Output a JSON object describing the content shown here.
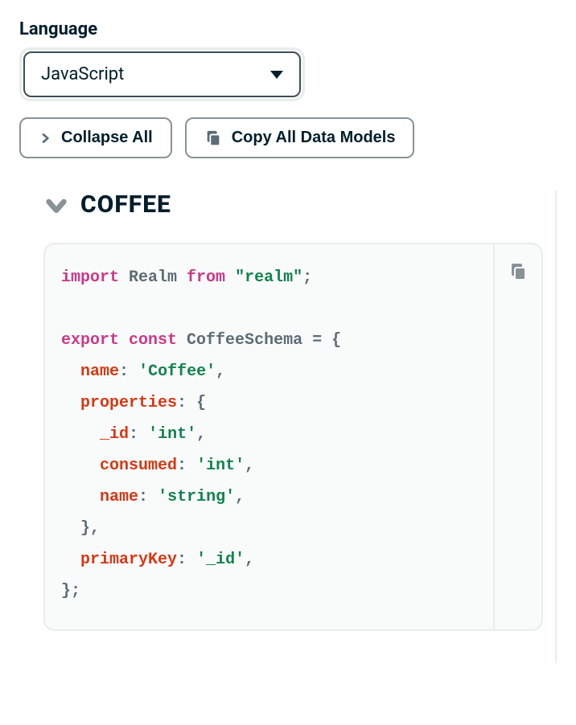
{
  "language": {
    "label": "Language",
    "selected": "JavaScript"
  },
  "buttons": {
    "collapse_all": "Collapse All",
    "copy_all": "Copy All Data Models"
  },
  "section": {
    "title": "COFFEE"
  },
  "code": {
    "tokens": [
      [
        {
          "t": "kw",
          "v": "import"
        },
        {
          "t": "plain",
          "v": " Realm "
        },
        {
          "t": "kw",
          "v": "from"
        },
        {
          "t": "plain",
          "v": " "
        },
        {
          "t": "str",
          "v": "\"realm\""
        },
        {
          "t": "punc",
          "v": ";"
        }
      ],
      [],
      [
        {
          "t": "kw",
          "v": "export"
        },
        {
          "t": "plain",
          "v": " "
        },
        {
          "t": "kw",
          "v": "const"
        },
        {
          "t": "plain",
          "v": " CoffeeSchema "
        },
        {
          "t": "punc",
          "v": "="
        },
        {
          "t": "plain",
          "v": " "
        },
        {
          "t": "punc",
          "v": "{"
        }
      ],
      [
        {
          "t": "plain",
          "v": "  "
        },
        {
          "t": "id",
          "v": "name"
        },
        {
          "t": "punc",
          "v": ":"
        },
        {
          "t": "plain",
          "v": " "
        },
        {
          "t": "str",
          "v": "'Coffee'"
        },
        {
          "t": "punc",
          "v": ","
        }
      ],
      [
        {
          "t": "plain",
          "v": "  "
        },
        {
          "t": "id",
          "v": "properties"
        },
        {
          "t": "punc",
          "v": ":"
        },
        {
          "t": "plain",
          "v": " "
        },
        {
          "t": "punc",
          "v": "{"
        }
      ],
      [
        {
          "t": "plain",
          "v": "    "
        },
        {
          "t": "id",
          "v": "_id"
        },
        {
          "t": "punc",
          "v": ":"
        },
        {
          "t": "plain",
          "v": " "
        },
        {
          "t": "str",
          "v": "'int'"
        },
        {
          "t": "punc",
          "v": ","
        }
      ],
      [
        {
          "t": "plain",
          "v": "    "
        },
        {
          "t": "id",
          "v": "consumed"
        },
        {
          "t": "punc",
          "v": ":"
        },
        {
          "t": "plain",
          "v": " "
        },
        {
          "t": "str",
          "v": "'int'"
        },
        {
          "t": "punc",
          "v": ","
        }
      ],
      [
        {
          "t": "plain",
          "v": "    "
        },
        {
          "t": "id",
          "v": "name"
        },
        {
          "t": "punc",
          "v": ":"
        },
        {
          "t": "plain",
          "v": " "
        },
        {
          "t": "str",
          "v": "'string'"
        },
        {
          "t": "punc",
          "v": ","
        }
      ],
      [
        {
          "t": "plain",
          "v": "  "
        },
        {
          "t": "punc",
          "v": "},"
        }
      ],
      [
        {
          "t": "plain",
          "v": "  "
        },
        {
          "t": "id",
          "v": "primaryKey"
        },
        {
          "t": "punc",
          "v": ":"
        },
        {
          "t": "plain",
          "v": " "
        },
        {
          "t": "str",
          "v": "'_id'"
        },
        {
          "t": "punc",
          "v": ","
        }
      ],
      [
        {
          "t": "punc",
          "v": "};"
        }
      ]
    ]
  }
}
